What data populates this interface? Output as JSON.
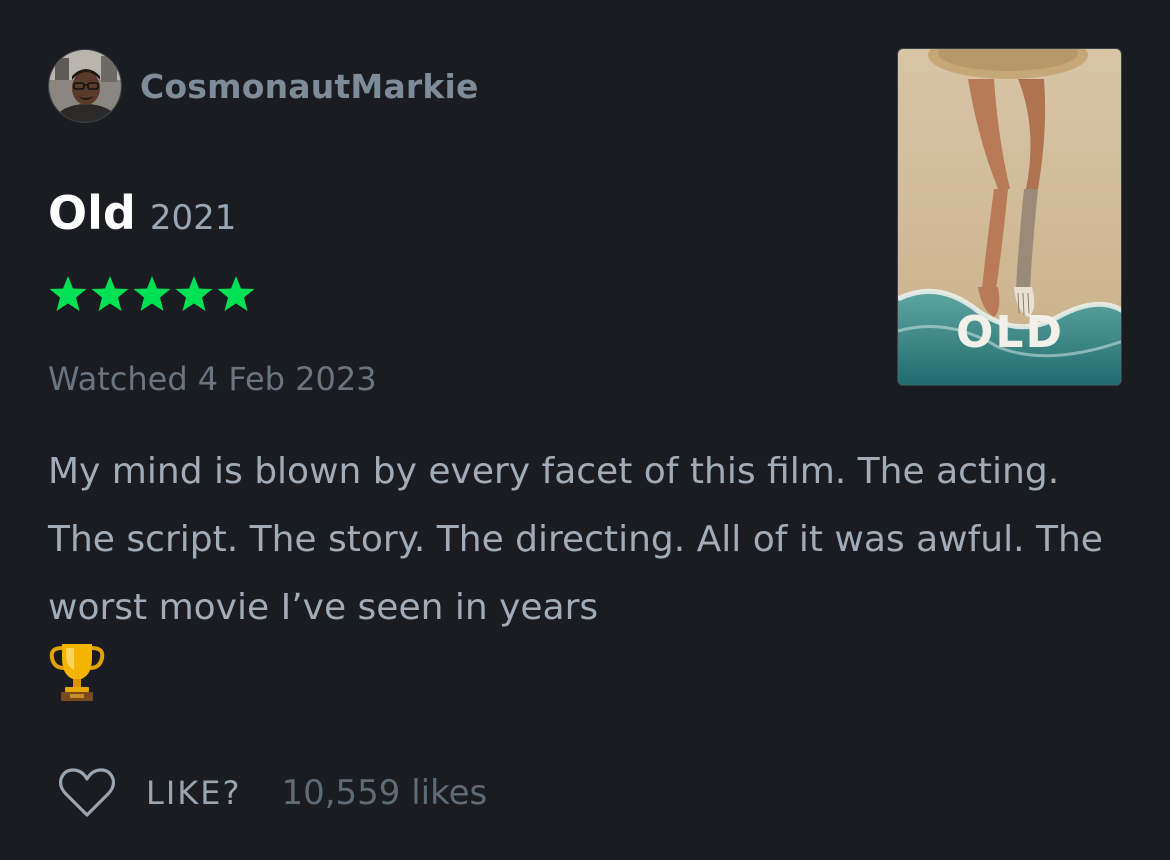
{
  "user": {
    "username": "CosmonautMarkie"
  },
  "film": {
    "title": "Old",
    "year": "2021",
    "rating_stars": 5,
    "rating_max": 5,
    "poster_title": "OLD"
  },
  "watched": "Watched 4 Feb 2023",
  "review": {
    "text": "My mind is blown by every facet of this film. The acting. The script. The story. The directing. All of it was awful. The worst movie I’ve seen in years",
    "emoji": "trophy"
  },
  "actions": {
    "like_label": "LIKE?",
    "likes_count": "10,559 likes"
  },
  "colors": {
    "background": "#1a1c21",
    "star": "#00e054",
    "username": "#7e8b99",
    "review_text": "#a1acb8"
  }
}
